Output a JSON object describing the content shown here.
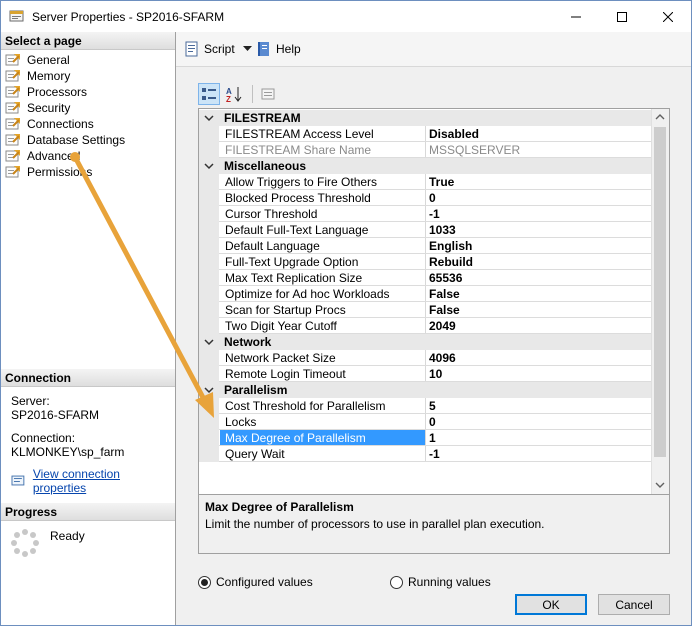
{
  "window": {
    "title": "Server Properties - SP2016-SFARM",
    "controls": [
      "minimize",
      "maximize",
      "close"
    ]
  },
  "left_panel": {
    "select_page_header": "Select a page",
    "pages": [
      {
        "label": "General",
        "icon": "wrench-icon"
      },
      {
        "label": "Memory",
        "icon": "wrench-icon"
      },
      {
        "label": "Processors",
        "icon": "wrench-icon"
      },
      {
        "label": "Security",
        "icon": "wrench-icon"
      },
      {
        "label": "Connections",
        "icon": "wrench-icon"
      },
      {
        "label": "Database Settings",
        "icon": "wrench-icon"
      },
      {
        "label": "Advanced",
        "icon": "wrench-icon"
      },
      {
        "label": "Permissions",
        "icon": "wrench-icon"
      }
    ],
    "connection_header": "Connection",
    "server_label": "Server:",
    "server_value": "SP2016-SFARM",
    "connection_label": "Connection:",
    "connection_value": "KLMONKEY\\sp_farm",
    "view_connection_link": "View connection properties",
    "progress_header": "Progress",
    "progress_status": "Ready"
  },
  "toolbar": {
    "script_label": "Script",
    "help_label": "Help"
  },
  "grid": {
    "rows": [
      {
        "type": "category",
        "name": "FILESTREAM"
      },
      {
        "type": "prop",
        "name": "FILESTREAM Access Level",
        "value": "Disabled"
      },
      {
        "type": "prop",
        "name": "FILESTREAM Share Name",
        "value": "MSSQLSERVER",
        "dim": true
      },
      {
        "type": "category",
        "name": "Miscellaneous"
      },
      {
        "type": "prop",
        "name": "Allow Triggers to Fire Others",
        "value": "True"
      },
      {
        "type": "prop",
        "name": "Blocked Process Threshold",
        "value": "0"
      },
      {
        "type": "prop",
        "name": "Cursor Threshold",
        "value": "-1"
      },
      {
        "type": "prop",
        "name": "Default Full-Text Language",
        "value": "1033"
      },
      {
        "type": "prop",
        "name": "Default Language",
        "value": "English"
      },
      {
        "type": "prop",
        "name": "Full-Text Upgrade Option",
        "value": "Rebuild"
      },
      {
        "type": "prop",
        "name": "Max Text Replication Size",
        "value": "65536"
      },
      {
        "type": "prop",
        "name": "Optimize for Ad hoc Workloads",
        "value": "False"
      },
      {
        "type": "prop",
        "name": "Scan for Startup Procs",
        "value": "False"
      },
      {
        "type": "prop",
        "name": "Two Digit Year Cutoff",
        "value": "2049"
      },
      {
        "type": "category",
        "name": "Network"
      },
      {
        "type": "prop",
        "name": "Network Packet Size",
        "value": "4096"
      },
      {
        "type": "prop",
        "name": "Remote Login Timeout",
        "value": "10"
      },
      {
        "type": "category",
        "name": "Parallelism"
      },
      {
        "type": "prop",
        "name": "Cost Threshold for Parallelism",
        "value": "5"
      },
      {
        "type": "prop",
        "name": "Locks",
        "value": "0"
      },
      {
        "type": "prop",
        "name": "Max Degree of Parallelism",
        "value": "1",
        "selected": true
      },
      {
        "type": "prop",
        "name": "Query Wait",
        "value": "-1"
      }
    ]
  },
  "description": {
    "title": "Max Degree of Parallelism",
    "text": "Limit the number of processors to use in parallel plan execution."
  },
  "options": {
    "configured_label": "Configured values",
    "running_label": "Running values",
    "selected": "configured"
  },
  "buttons": {
    "ok_label": "OK",
    "cancel_label": "Cancel"
  },
  "colors": {
    "selection": "#3399ff",
    "annotation_arrow": "#e8a33a",
    "link": "#0645ad"
  }
}
